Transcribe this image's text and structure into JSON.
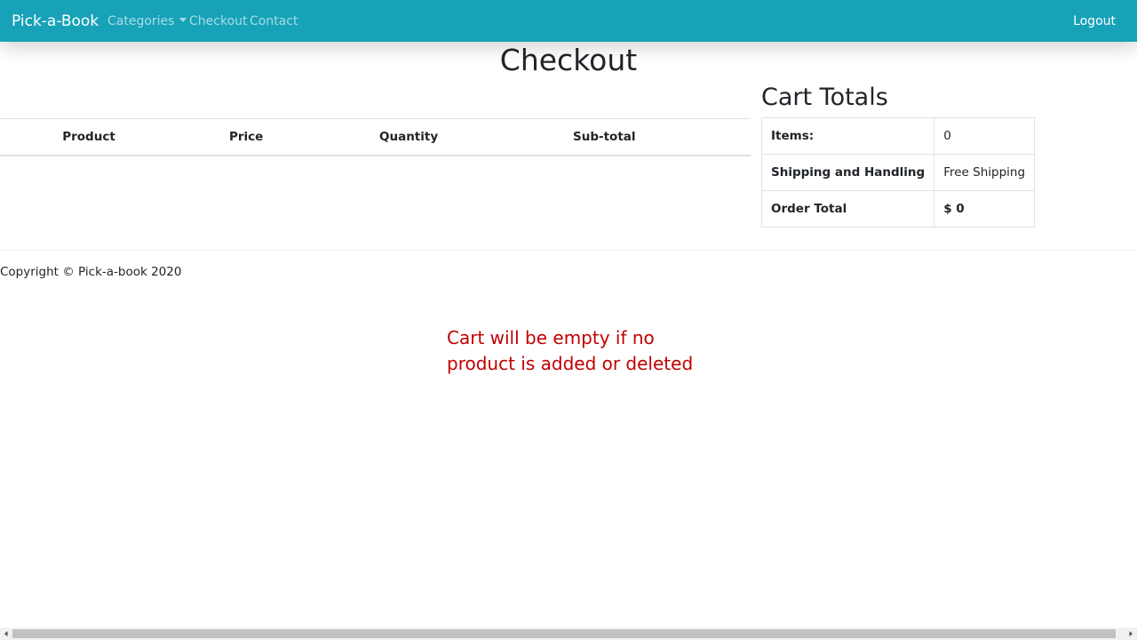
{
  "navbar": {
    "brand": "Pick-a-Book",
    "items": [
      {
        "label": "Categories",
        "has_dropdown": true
      },
      {
        "label": "Checkout"
      },
      {
        "label": "Contact"
      }
    ],
    "logout": "Logout",
    "color": "#17a2b8"
  },
  "page": {
    "title": "Checkout"
  },
  "products_table": {
    "columns": [
      "Product",
      "Price",
      "Quantity",
      "Sub-total"
    ],
    "rows": []
  },
  "cart_totals": {
    "title": "Cart Totals",
    "rows": [
      {
        "label": "Items:",
        "value": "0"
      },
      {
        "label": "Shipping and Handling",
        "value": "Free Shipping"
      },
      {
        "label": "Order Total",
        "value": "$ 0"
      }
    ]
  },
  "footer": {
    "copyright": "Copyright © Pick-a-book 2020"
  },
  "annotation": {
    "text": "Cart will be empty if no product is added or deleted",
    "color": "#c00000"
  },
  "icons": {
    "dropdown": "caret-down-icon",
    "scroll_left": "arrow-left-icon",
    "scroll_right": "arrow-right-icon"
  }
}
